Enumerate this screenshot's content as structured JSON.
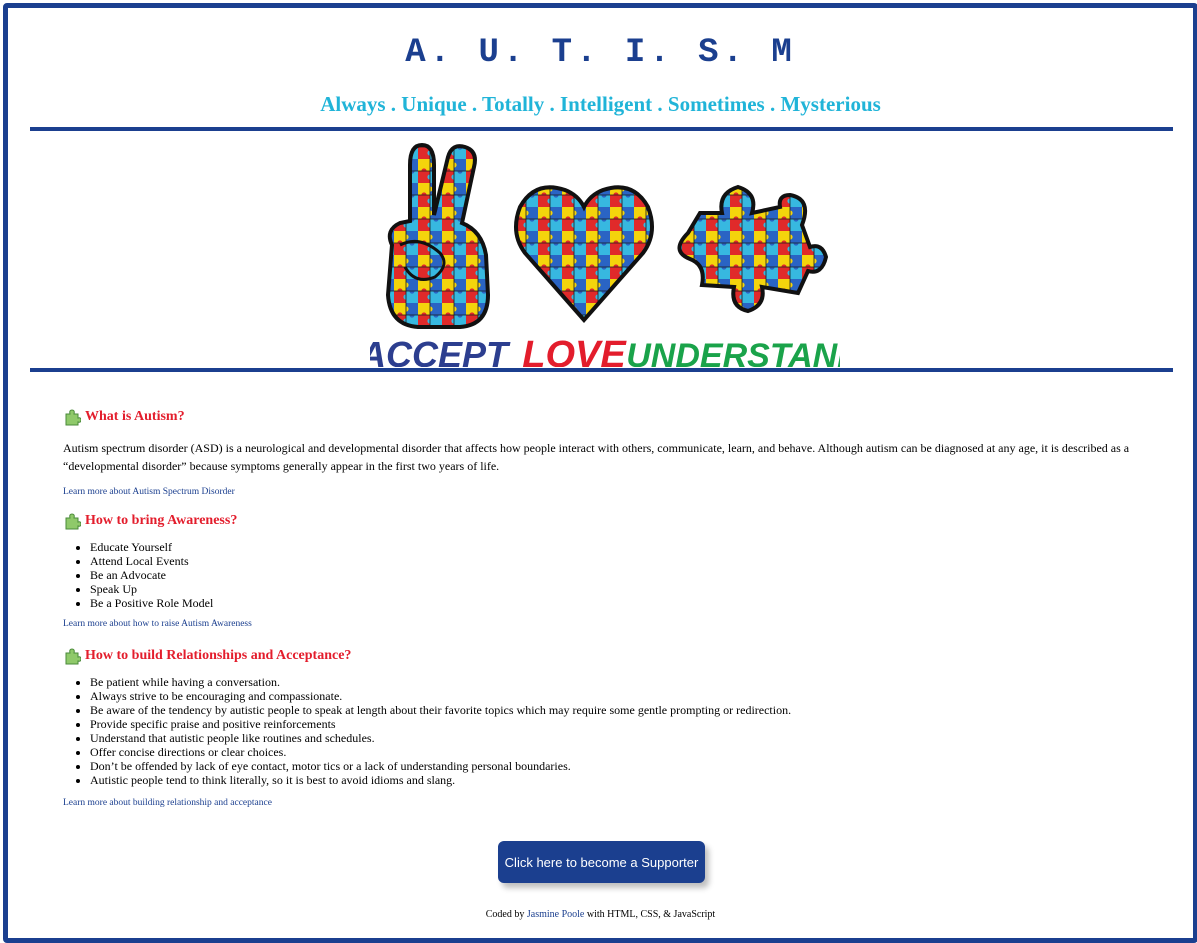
{
  "header": {
    "title": "A. U. T. I. S. M",
    "tagline": "Always . Unique . Totally . Intelligent . Sometimes . Mysterious"
  },
  "banner": {
    "words": [
      "ACCEPT",
      "LOVE",
      "UNDERSTAND"
    ],
    "colors": {
      "accept": "#2c3e8f",
      "love": "#e31d2c",
      "understand": "#1aa34a"
    }
  },
  "sections": [
    {
      "heading": "What is Autism?",
      "paragraph": "Autism spectrum disorder (ASD) is a neurological and developmental disorder that affects how people interact with others, communicate, learn, and behave. Although autism can be diagnosed at any age, it is described as a “developmental disorder” because symptoms generally appear in the first two years of life.",
      "link": "Learn more about Autism Spectrum Disorder"
    },
    {
      "heading": "How to bring Awareness?",
      "items": [
        "Educate Yourself",
        "Attend Local Events",
        "Be an Advocate",
        "Speak Up",
        "Be a Positive Role Model"
      ],
      "link": "Learn more about how to raise Autism Awareness"
    },
    {
      "heading": "How to build Relationships and Acceptance?",
      "items": [
        "Be patient while having a conversation.",
        "Always strive to be encouraging and compassionate.",
        "Be aware of the tendency by autistic people to speak at length about their favorite topics which may require some gentle prompting or redirection.",
        "Provide specific praise and positive reinforcements",
        "Understand that autistic people like routines and schedules.",
        "Offer concise directions or clear choices.",
        "Don’t be offended by lack of eye contact, motor tics or a lack of understanding personal boundaries.",
        "Autistic people tend to think literally, so it is best to avoid idioms and slang."
      ],
      "link": "Learn more about building relationship and acceptance"
    }
  ],
  "cta": {
    "label": "Click here to become a Supporter"
  },
  "footer": {
    "prefix": "Coded by",
    "author": "Jasmine Poole",
    "suffix": "with HTML, CSS, & JavaScript"
  },
  "colors": {
    "primary": "#1b3f8f",
    "accent": "#20b4d8",
    "heading": "#e31d2c"
  }
}
